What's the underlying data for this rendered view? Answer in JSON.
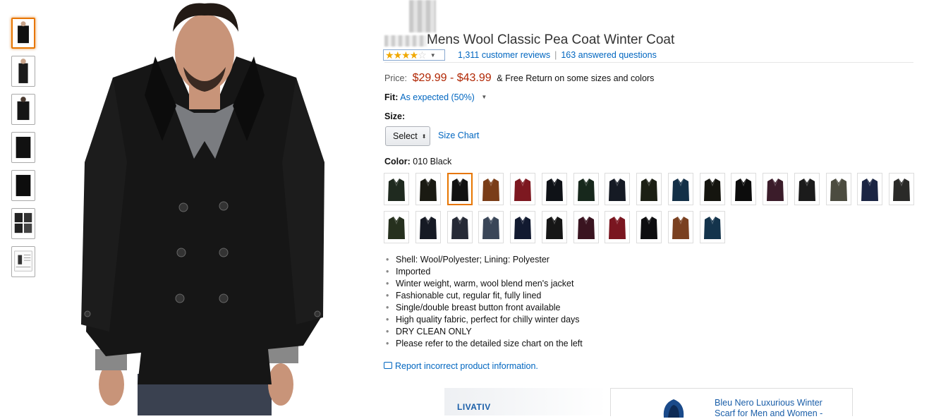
{
  "product": {
    "title": "Mens Wool Classic Pea Coat Winter Coat",
    "rating_stars": "★★★★",
    "rating_empty": "☆",
    "reviews_label": "1,311 customer reviews",
    "separator": "|",
    "answered_label": "163 answered questions"
  },
  "price": {
    "label": "Price:",
    "value": "$29.99 - $43.99",
    "note": "& Free Return on some sizes and colors"
  },
  "fit": {
    "label": "Fit:",
    "value": "As expected (50%)"
  },
  "size": {
    "label": "Size:",
    "select_value": "Select",
    "chart_link": "Size Chart"
  },
  "color": {
    "label": "Color:",
    "value": "010 Black",
    "swatches": [
      {
        "name": "swatch-1",
        "color": "#1f2a1f"
      },
      {
        "name": "swatch-2",
        "color": "#1a1a12"
      },
      {
        "name": "swatch-3",
        "color": "#111111",
        "selected": true
      },
      {
        "name": "swatch-4",
        "color": "#7a3d18"
      },
      {
        "name": "swatch-5",
        "color": "#7d1820"
      },
      {
        "name": "swatch-6",
        "color": "#0f1217"
      },
      {
        "name": "swatch-7",
        "color": "#17281c"
      },
      {
        "name": "swatch-8",
        "color": "#151a24"
      },
      {
        "name": "swatch-9",
        "color": "#1c1f14"
      },
      {
        "name": "swatch-10",
        "color": "#133047"
      },
      {
        "name": "swatch-11",
        "color": "#15150f"
      },
      {
        "name": "swatch-12",
        "color": "#0c0c0c"
      },
      {
        "name": "swatch-13",
        "color": "#3b1c2a"
      },
      {
        "name": "swatch-14",
        "color": "#1b1b1b"
      },
      {
        "name": "swatch-15",
        "color": "#4c4c40"
      },
      {
        "name": "swatch-16",
        "color": "#1b2543"
      },
      {
        "name": "swatch-17",
        "color": "#2a2a28"
      },
      {
        "name": "swatch-18",
        "color": "#26301e"
      },
      {
        "name": "swatch-19",
        "color": "#161a24"
      },
      {
        "name": "swatch-20",
        "color": "#262a36"
      },
      {
        "name": "swatch-21",
        "color": "#3a4658"
      },
      {
        "name": "swatch-22",
        "color": "#121a30"
      },
      {
        "name": "swatch-23",
        "color": "#161616"
      },
      {
        "name": "swatch-24",
        "color": "#3a1420"
      },
      {
        "name": "swatch-25",
        "color": "#7a1620"
      },
      {
        "name": "swatch-26",
        "color": "#0e0e10"
      },
      {
        "name": "swatch-27",
        "color": "#7a4020"
      },
      {
        "name": "swatch-28",
        "color": "#14344c"
      }
    ]
  },
  "bullets": [
    "Shell: Wool/Polyester; Lining: Polyester",
    "Imported",
    "Winter weight, warm, wool blend men's jacket",
    "Fashionable cut, regular fit, fully lined",
    "Single/double breast button front available",
    "High quality fabric, perfect for chilly winter days",
    "DRY CLEAN ONLY",
    "Please refer to the detailed size chart on the left"
  ],
  "report_link": "Report incorrect product information.",
  "ads": {
    "left_brand": "LIVATIV",
    "right_title": "Bleu Nero Luxurious Winter Scarf for Men and Women -"
  },
  "thumbnails": [
    "thumb-front",
    "thumb-side",
    "thumb-back",
    "thumb-detail-1",
    "thumb-detail-2",
    "thumb-colors",
    "thumb-size-chart"
  ]
}
